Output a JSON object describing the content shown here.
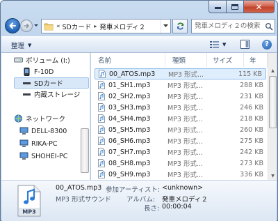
{
  "window": {
    "controls": {
      "minimize": "minimize",
      "maximize": "maximize",
      "close": "✕"
    }
  },
  "address": {
    "overflow": "«",
    "crumbs": [
      "SDカード",
      "発車メロディ２"
    ],
    "separator": "▸"
  },
  "search": {
    "placeholder": "発車メロディ２の検索"
  },
  "toolbar": {
    "organize_label": "整理",
    "dropdown_arrow": "▼",
    "help": "?"
  },
  "navigation": {
    "items": [
      {
        "label": "ボリューム (I:)",
        "icon": "drive-icon"
      },
      {
        "label": "F-10D",
        "icon": "phone-icon"
      },
      {
        "label": "SDカード",
        "icon": "sdcard-icon",
        "selected": true
      },
      {
        "label": "内蔵ストレージ",
        "icon": "storage-icon"
      },
      {
        "label": "ネットワーク",
        "icon": "network-icon"
      },
      {
        "label": "DELL-8300",
        "icon": "computer-icon"
      },
      {
        "label": "RIKA-PC",
        "icon": "computer-icon"
      },
      {
        "label": "SHOHEI-PC",
        "icon": "computer-icon"
      }
    ]
  },
  "filelist": {
    "columns": {
      "name": "名前",
      "type": "種類",
      "size": "サイズ",
      "year": "年"
    },
    "rows": [
      {
        "name": "00_ATOS.mp3",
        "type": "MP3 形式...",
        "size": "115 KB",
        "selected": true
      },
      {
        "name": "01_SH1.mp3",
        "type": "MP3 形式...",
        "size": "288 KB"
      },
      {
        "name": "02_SH2.mp3",
        "type": "MP3 形式...",
        "size": "231 KB"
      },
      {
        "name": "03_SH3.mp3",
        "type": "MP3 形式...",
        "size": "246 KB"
      },
      {
        "name": "04_SH4.mp3",
        "type": "MP3 形式...",
        "size": "218 KB"
      },
      {
        "name": "05_SH5.mp3",
        "type": "MP3 形式...",
        "size": "260 KB"
      },
      {
        "name": "06_SH6.mp3",
        "type": "MP3 形式...",
        "size": "275 KB"
      },
      {
        "name": "07_SH7.mp3",
        "type": "MP3 形式...",
        "size": "242 KB"
      },
      {
        "name": "08_SH8.mp3",
        "type": "MP3 形式...",
        "size": "273 KB"
      },
      {
        "name": "09_SH9.mp3",
        "type": "MP3 形式...",
        "size": "336 KB"
      }
    ]
  },
  "details": {
    "icon_text": "MP3",
    "title": "00_ATOS.mp3",
    "type": "MP3 形式サウンド",
    "artist_label": "参加アーティスト:",
    "artist_value": "<unknown>",
    "album_label": "アルバム:",
    "album_value": "発車メロディ２",
    "length_label": "長さ:",
    "length_value": "00:00:04"
  },
  "colors": {
    "titlebar": "#b6cde8",
    "selection": "#dfeefc",
    "selection_border": "#8fbbea",
    "close_button": "#c2432b"
  }
}
